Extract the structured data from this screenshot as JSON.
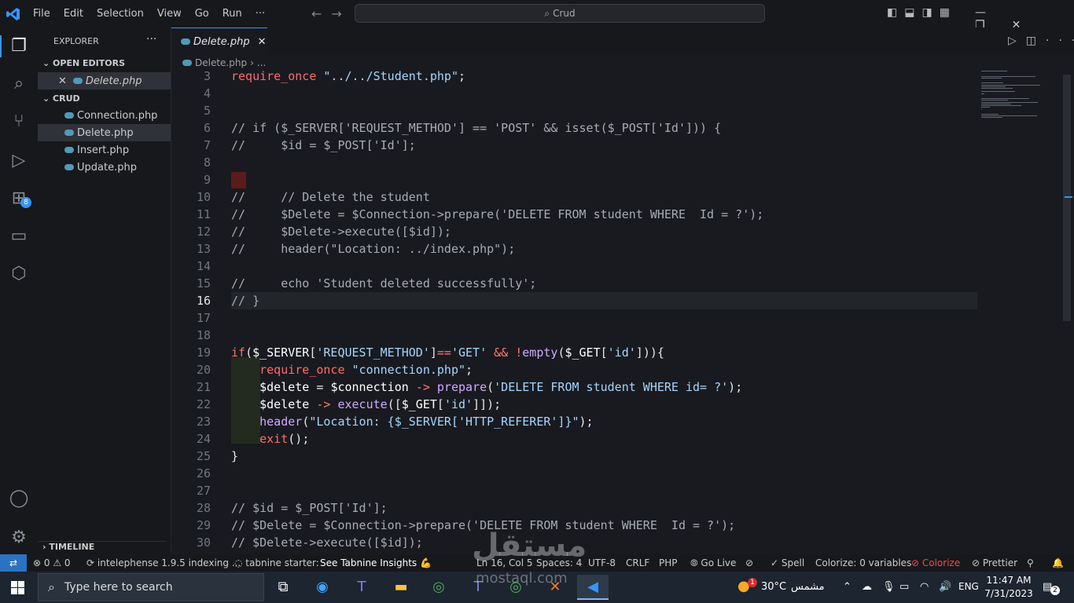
{
  "titlebar": {
    "menu": [
      "File",
      "Edit",
      "Selection",
      "View",
      "Go",
      "Run",
      "···"
    ],
    "search": "Crud"
  },
  "sidebar": {
    "title": "EXPLORER",
    "open_editors_label": "OPEN EDITORS",
    "open_editor_file": "Delete.php",
    "folder_label": "CRUD",
    "files": [
      "Connection.php",
      "Delete.php",
      "Insert.php",
      "Update.php"
    ],
    "timeline_label": "TIMELINE",
    "extensions_badge": "8"
  },
  "editor": {
    "tab_label": "Delete.php",
    "breadcrumb_file": "Delete.php",
    "breadcrumb_more": "...",
    "current_line": 16,
    "lines": [
      {
        "n": "3",
        "t": "require_once \"../../Student.php\";"
      },
      {
        "n": "4",
        "t": ""
      },
      {
        "n": "5",
        "t": ""
      },
      {
        "n": "6",
        "t": "// if ($_SERVER['REQUEST_METHOD'] == 'POST' && isset($_POST['Id'])) {"
      },
      {
        "n": "7",
        "t": "//     $id = $_POST['Id'];"
      },
      {
        "n": "8",
        "t": ""
      },
      {
        "n": "9",
        "t": ""
      },
      {
        "n": "10",
        "t": "//     // Delete the student"
      },
      {
        "n": "11",
        "t": "//     $Delete = $Connection->prepare('DELETE FROM student WHERE  Id = ?');"
      },
      {
        "n": "12",
        "t": "//     $Delete->execute([$id]);"
      },
      {
        "n": "13",
        "t": "//     header(\"Location: ../index.php\");"
      },
      {
        "n": "14",
        "t": ""
      },
      {
        "n": "15",
        "t": "//     echo 'Student deleted successfully';"
      },
      {
        "n": "16",
        "t": "// }"
      },
      {
        "n": "17",
        "t": ""
      },
      {
        "n": "18",
        "t": ""
      },
      {
        "n": "19",
        "t": "if($_SERVER['REQUEST_METHOD']=='GET' && !empty($_GET['id'])){"
      },
      {
        "n": "20",
        "t": "    require_once \"connection.php\";"
      },
      {
        "n": "21",
        "t": "    $delete = $connection -> prepare('DELETE FROM student WHERE id= ?');"
      },
      {
        "n": "22",
        "t": "    $delete -> execute([$_GET['id']]);"
      },
      {
        "n": "23",
        "t": "    header(\"Location: {$_SERVER['HTTP_REFERER']}\");"
      },
      {
        "n": "24",
        "t": "    exit();"
      },
      {
        "n": "25",
        "t": "}"
      },
      {
        "n": "26",
        "t": ""
      },
      {
        "n": "27",
        "t": ""
      },
      {
        "n": "28",
        "t": "// $id = $_POST['Id'];"
      },
      {
        "n": "29",
        "t": "// $Delete = $Connection->prepare('DELETE FROM student WHERE  Id = ?');"
      },
      {
        "n": "30",
        "t": "// $Delete->execute([$id]);"
      }
    ]
  },
  "statusbar": {
    "problems": "⊗ 0 ⚠ 0",
    "intelephense": "intelephense 1.9.5 indexing ...",
    "tabnine": "tabnine starter:",
    "tabnine_insights": "See Tabnine Insights 💪",
    "position": "Ln 16, Col 5",
    "spaces": "Spaces: 4",
    "encoding": "UTF-8",
    "eol": "CRLF",
    "language": "PHP",
    "golive": "Go Live",
    "spell": "Spell",
    "colorize_vars": "Colorize: 0 variables",
    "colorize": "Colorize",
    "prettier": "Prettier"
  },
  "taskbar": {
    "search_placeholder": "Type here to search",
    "weather_temp": "30°C",
    "weather_label": "مشمس",
    "weather_badge": "1",
    "lang": "ENG",
    "time": "11:47 AM",
    "date": "7/31/2023",
    "notif_count": "2"
  },
  "watermark": {
    "main": "مستقل",
    "sub": "mostaql.com"
  },
  "colors": {
    "accent": "#3794ff",
    "remote": "#2b73c2",
    "colorize_error": "#f14c4c"
  }
}
